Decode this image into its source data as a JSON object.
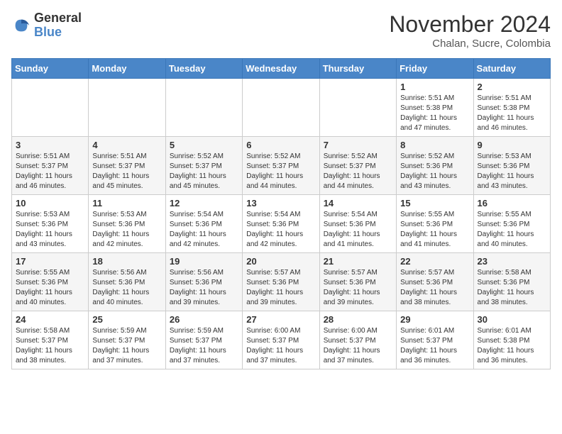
{
  "header": {
    "logo_line1": "General",
    "logo_line2": "Blue",
    "month_year": "November 2024",
    "location": "Chalan, Sucre, Colombia"
  },
  "weekdays": [
    "Sunday",
    "Monday",
    "Tuesday",
    "Wednesday",
    "Thursday",
    "Friday",
    "Saturday"
  ],
  "weeks": [
    [
      {
        "day": "",
        "info": ""
      },
      {
        "day": "",
        "info": ""
      },
      {
        "day": "",
        "info": ""
      },
      {
        "day": "",
        "info": ""
      },
      {
        "day": "",
        "info": ""
      },
      {
        "day": "1",
        "info": "Sunrise: 5:51 AM\nSunset: 5:38 PM\nDaylight: 11 hours\nand 47 minutes."
      },
      {
        "day": "2",
        "info": "Sunrise: 5:51 AM\nSunset: 5:38 PM\nDaylight: 11 hours\nand 46 minutes."
      }
    ],
    [
      {
        "day": "3",
        "info": "Sunrise: 5:51 AM\nSunset: 5:37 PM\nDaylight: 11 hours\nand 46 minutes."
      },
      {
        "day": "4",
        "info": "Sunrise: 5:51 AM\nSunset: 5:37 PM\nDaylight: 11 hours\nand 45 minutes."
      },
      {
        "day": "5",
        "info": "Sunrise: 5:52 AM\nSunset: 5:37 PM\nDaylight: 11 hours\nand 45 minutes."
      },
      {
        "day": "6",
        "info": "Sunrise: 5:52 AM\nSunset: 5:37 PM\nDaylight: 11 hours\nand 44 minutes."
      },
      {
        "day": "7",
        "info": "Sunrise: 5:52 AM\nSunset: 5:37 PM\nDaylight: 11 hours\nand 44 minutes."
      },
      {
        "day": "8",
        "info": "Sunrise: 5:52 AM\nSunset: 5:36 PM\nDaylight: 11 hours\nand 43 minutes."
      },
      {
        "day": "9",
        "info": "Sunrise: 5:53 AM\nSunset: 5:36 PM\nDaylight: 11 hours\nand 43 minutes."
      }
    ],
    [
      {
        "day": "10",
        "info": "Sunrise: 5:53 AM\nSunset: 5:36 PM\nDaylight: 11 hours\nand 43 minutes."
      },
      {
        "day": "11",
        "info": "Sunrise: 5:53 AM\nSunset: 5:36 PM\nDaylight: 11 hours\nand 42 minutes."
      },
      {
        "day": "12",
        "info": "Sunrise: 5:54 AM\nSunset: 5:36 PM\nDaylight: 11 hours\nand 42 minutes."
      },
      {
        "day": "13",
        "info": "Sunrise: 5:54 AM\nSunset: 5:36 PM\nDaylight: 11 hours\nand 42 minutes."
      },
      {
        "day": "14",
        "info": "Sunrise: 5:54 AM\nSunset: 5:36 PM\nDaylight: 11 hours\nand 41 minutes."
      },
      {
        "day": "15",
        "info": "Sunrise: 5:55 AM\nSunset: 5:36 PM\nDaylight: 11 hours\nand 41 minutes."
      },
      {
        "day": "16",
        "info": "Sunrise: 5:55 AM\nSunset: 5:36 PM\nDaylight: 11 hours\nand 40 minutes."
      }
    ],
    [
      {
        "day": "17",
        "info": "Sunrise: 5:55 AM\nSunset: 5:36 PM\nDaylight: 11 hours\nand 40 minutes."
      },
      {
        "day": "18",
        "info": "Sunrise: 5:56 AM\nSunset: 5:36 PM\nDaylight: 11 hours\nand 40 minutes."
      },
      {
        "day": "19",
        "info": "Sunrise: 5:56 AM\nSunset: 5:36 PM\nDaylight: 11 hours\nand 39 minutes."
      },
      {
        "day": "20",
        "info": "Sunrise: 5:57 AM\nSunset: 5:36 PM\nDaylight: 11 hours\nand 39 minutes."
      },
      {
        "day": "21",
        "info": "Sunrise: 5:57 AM\nSunset: 5:36 PM\nDaylight: 11 hours\nand 39 minutes."
      },
      {
        "day": "22",
        "info": "Sunrise: 5:57 AM\nSunset: 5:36 PM\nDaylight: 11 hours\nand 38 minutes."
      },
      {
        "day": "23",
        "info": "Sunrise: 5:58 AM\nSunset: 5:36 PM\nDaylight: 11 hours\nand 38 minutes."
      }
    ],
    [
      {
        "day": "24",
        "info": "Sunrise: 5:58 AM\nSunset: 5:37 PM\nDaylight: 11 hours\nand 38 minutes."
      },
      {
        "day": "25",
        "info": "Sunrise: 5:59 AM\nSunset: 5:37 PM\nDaylight: 11 hours\nand 37 minutes."
      },
      {
        "day": "26",
        "info": "Sunrise: 5:59 AM\nSunset: 5:37 PM\nDaylight: 11 hours\nand 37 minutes."
      },
      {
        "day": "27",
        "info": "Sunrise: 6:00 AM\nSunset: 5:37 PM\nDaylight: 11 hours\nand 37 minutes."
      },
      {
        "day": "28",
        "info": "Sunrise: 6:00 AM\nSunset: 5:37 PM\nDaylight: 11 hours\nand 37 minutes."
      },
      {
        "day": "29",
        "info": "Sunrise: 6:01 AM\nSunset: 5:37 PM\nDaylight: 11 hours\nand 36 minutes."
      },
      {
        "day": "30",
        "info": "Sunrise: 6:01 AM\nSunset: 5:38 PM\nDaylight: 11 hours\nand 36 minutes."
      }
    ]
  ]
}
